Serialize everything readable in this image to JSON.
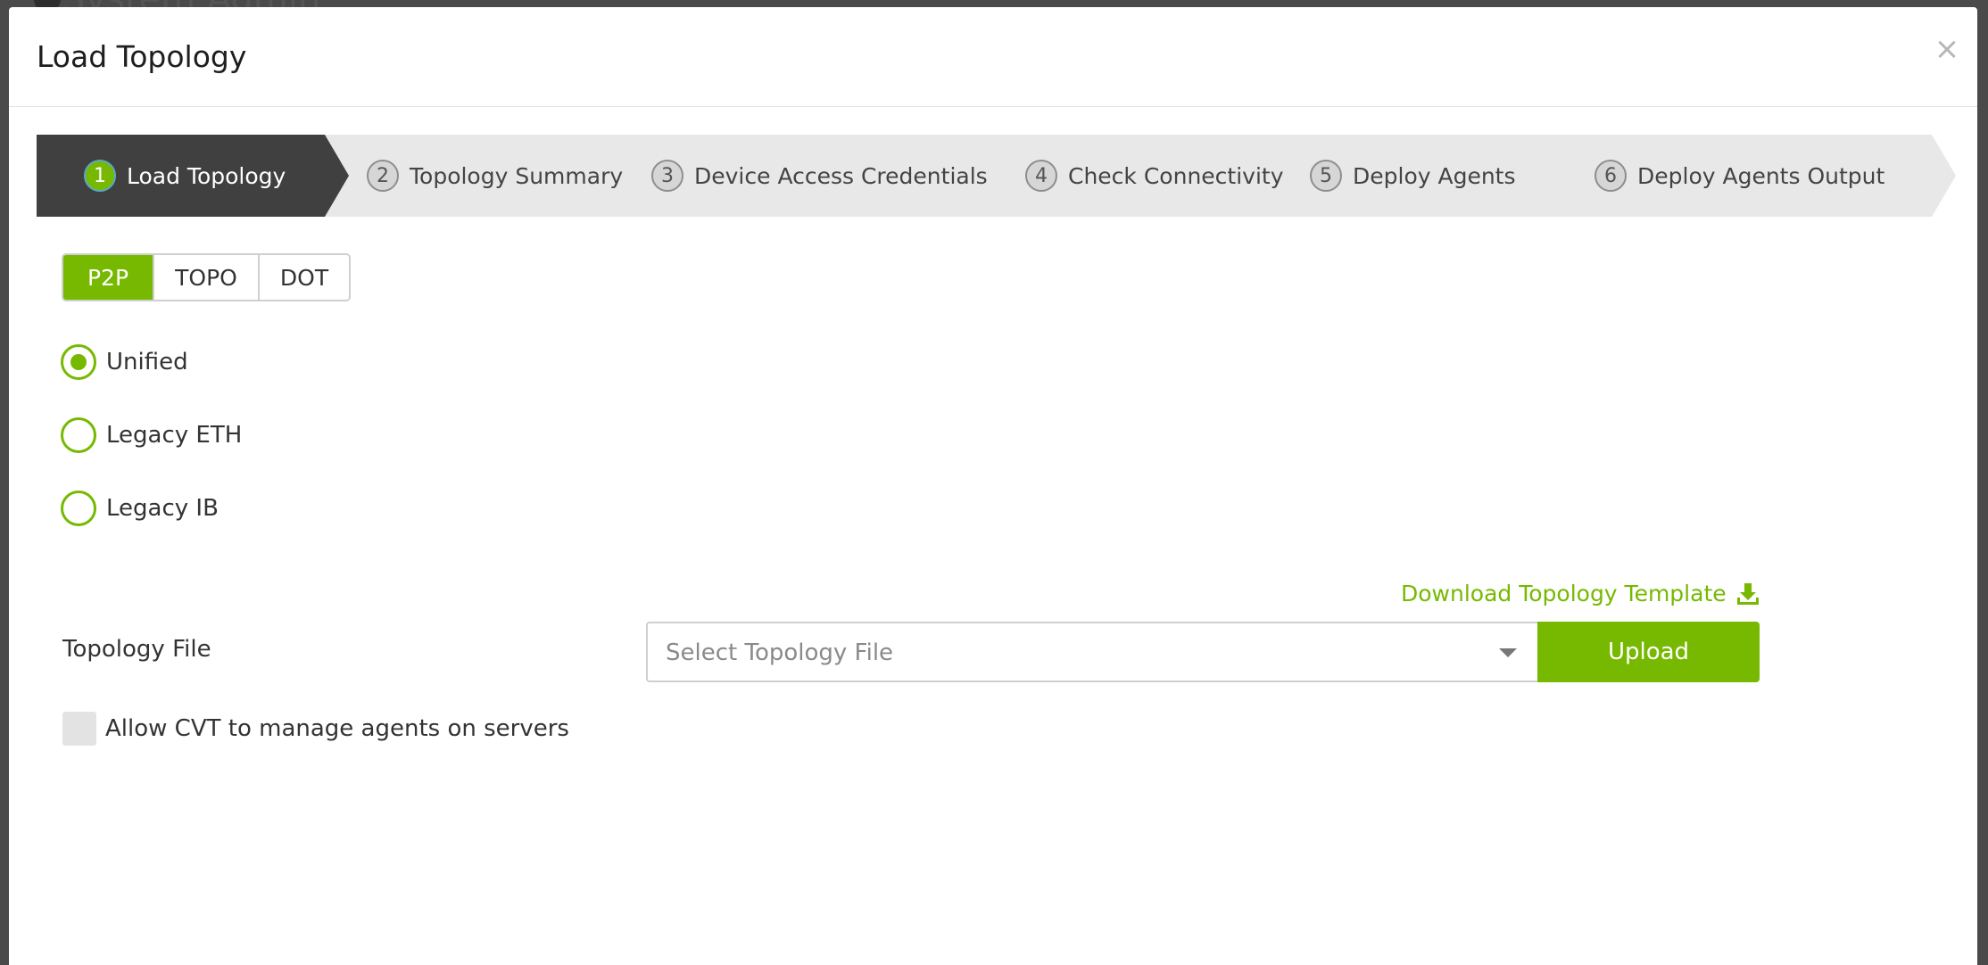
{
  "background": {
    "title": "System Admin"
  },
  "modal": {
    "title": "Load Topology",
    "close_glyph": "×"
  },
  "steps": [
    {
      "num": "1",
      "label": "Load Topology",
      "active": true
    },
    {
      "num": "2",
      "label": "Topology Summary",
      "active": false
    },
    {
      "num": "3",
      "label": "Device Access Credentials",
      "active": false
    },
    {
      "num": "4",
      "label": "Check Connectivity",
      "active": false
    },
    {
      "num": "5",
      "label": "Deploy Agents",
      "active": false
    },
    {
      "num": "6",
      "label": "Deploy Agents Output",
      "active": false
    }
  ],
  "format_tabs": [
    {
      "label": "P2P",
      "active": true
    },
    {
      "label": "TOPO",
      "active": false
    },
    {
      "label": "DOT",
      "active": false
    }
  ],
  "radio_options": [
    {
      "label": "Unified",
      "selected": true
    },
    {
      "label": "Legacy ETH",
      "selected": false
    },
    {
      "label": "Legacy IB",
      "selected": false
    }
  ],
  "download_link": {
    "label": "Download Topology Template",
    "icon": "download-icon"
  },
  "topology_file": {
    "label": "Topology File",
    "placeholder": "Select Topology File",
    "upload_label": "Upload"
  },
  "allow_agents": {
    "label": "Allow CVT to manage agents on servers",
    "checked": false
  },
  "colors": {
    "accent": "#76b900",
    "active_step": "#404040",
    "inactive_step": "#e8e8e8"
  }
}
